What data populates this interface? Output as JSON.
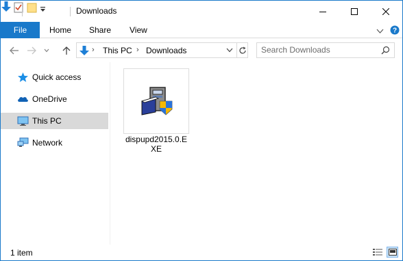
{
  "window": {
    "title": "Downloads"
  },
  "titlebar": {
    "buttons": [
      "minimize",
      "maximize",
      "close"
    ]
  },
  "ribbon": {
    "file_label": "File",
    "tabs": [
      "Home",
      "Share",
      "View"
    ]
  },
  "address": {
    "crumbs": [
      "This PC",
      "Downloads"
    ]
  },
  "search": {
    "placeholder": "Search Downloads"
  },
  "navpane": {
    "items": [
      {
        "label": "Quick access",
        "icon": "star-icon"
      },
      {
        "label": "OneDrive",
        "icon": "cloud-icon"
      },
      {
        "label": "This PC",
        "icon": "computer-icon",
        "selected": true
      },
      {
        "label": "Network",
        "icon": "network-icon"
      }
    ]
  },
  "files": [
    {
      "name": "dispupd2015.0.EXE",
      "icon": "installer-icon"
    }
  ],
  "status": {
    "item_count": "1 item"
  },
  "colors": {
    "accent": "#1979ca",
    "selection": "#d9d9d9"
  }
}
